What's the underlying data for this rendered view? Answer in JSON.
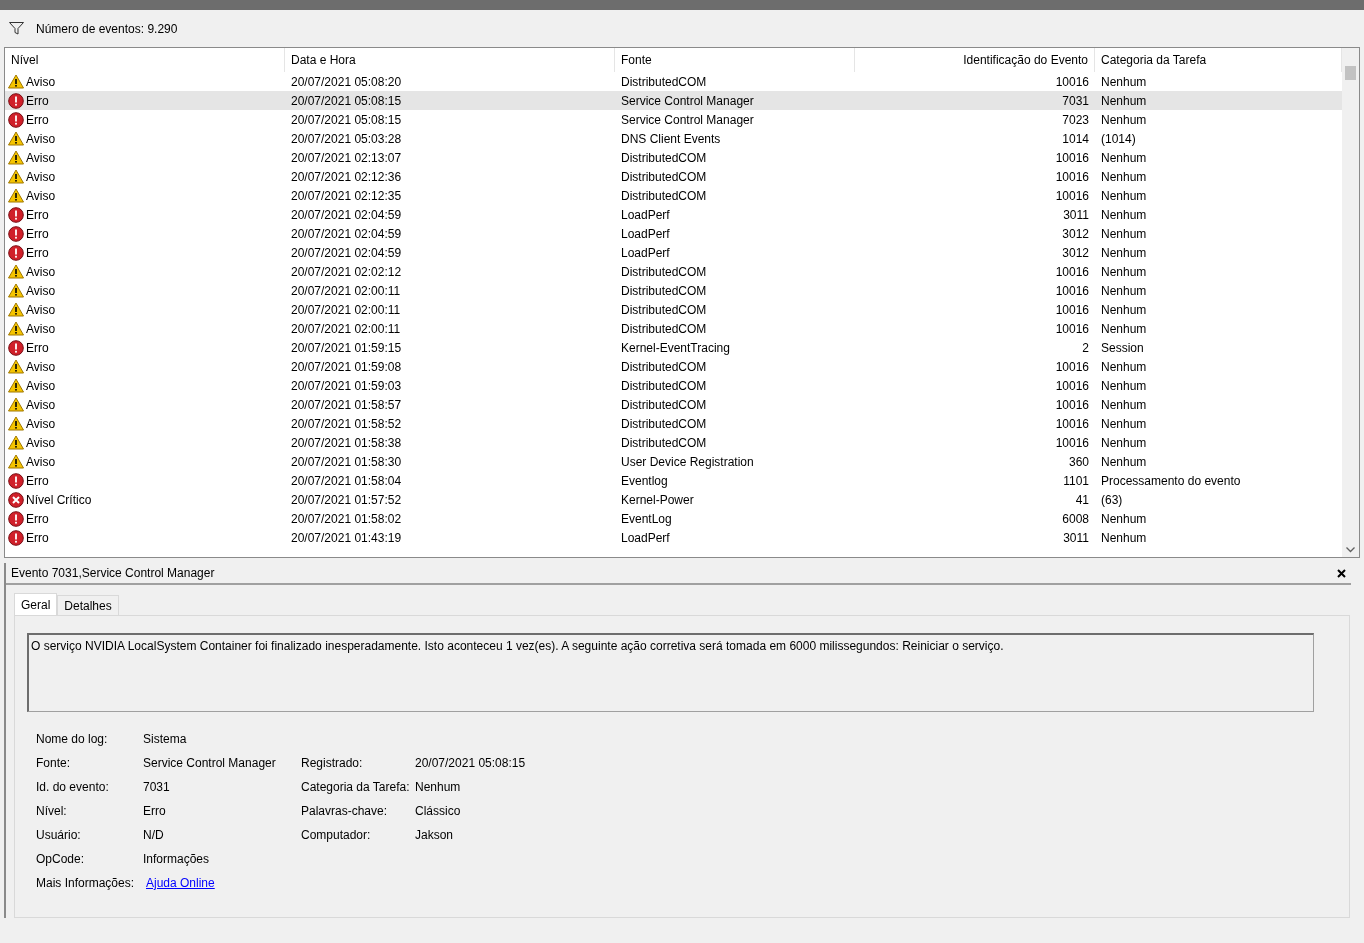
{
  "filter_bar": {
    "count_label": "Número de eventos: 9.290"
  },
  "table": {
    "columns": [
      "Nível",
      "Data e Hora",
      "Fonte",
      "Identificação do Evento",
      "Categoria da Tarefa"
    ],
    "rows": [
      {
        "kind": "warning",
        "level": "Aviso",
        "date": "20/07/2021 05:08:20",
        "source": "DistributedCOM",
        "id": "10016",
        "category": "Nenhum",
        "selected": false
      },
      {
        "kind": "error",
        "level": "Erro",
        "date": "20/07/2021 05:08:15",
        "source": "Service Control Manager",
        "id": "7031",
        "category": "Nenhum",
        "selected": true
      },
      {
        "kind": "error",
        "level": "Erro",
        "date": "20/07/2021 05:08:15",
        "source": "Service Control Manager",
        "id": "7023",
        "category": "Nenhum",
        "selected": false
      },
      {
        "kind": "warning",
        "level": "Aviso",
        "date": "20/07/2021 05:03:28",
        "source": "DNS Client Events",
        "id": "1014",
        "category": "(1014)",
        "selected": false
      },
      {
        "kind": "warning",
        "level": "Aviso",
        "date": "20/07/2021 02:13:07",
        "source": "DistributedCOM",
        "id": "10016",
        "category": "Nenhum",
        "selected": false
      },
      {
        "kind": "warning",
        "level": "Aviso",
        "date": "20/07/2021 02:12:36",
        "source": "DistributedCOM",
        "id": "10016",
        "category": "Nenhum",
        "selected": false
      },
      {
        "kind": "warning",
        "level": "Aviso",
        "date": "20/07/2021 02:12:35",
        "source": "DistributedCOM",
        "id": "10016",
        "category": "Nenhum",
        "selected": false
      },
      {
        "kind": "error",
        "level": "Erro",
        "date": "20/07/2021 02:04:59",
        "source": "LoadPerf",
        "id": "3011",
        "category": "Nenhum",
        "selected": false
      },
      {
        "kind": "error",
        "level": "Erro",
        "date": "20/07/2021 02:04:59",
        "source": "LoadPerf",
        "id": "3012",
        "category": "Nenhum",
        "selected": false
      },
      {
        "kind": "error",
        "level": "Erro",
        "date": "20/07/2021 02:04:59",
        "source": "LoadPerf",
        "id": "3012",
        "category": "Nenhum",
        "selected": false
      },
      {
        "kind": "warning",
        "level": "Aviso",
        "date": "20/07/2021 02:02:12",
        "source": "DistributedCOM",
        "id": "10016",
        "category": "Nenhum",
        "selected": false
      },
      {
        "kind": "warning",
        "level": "Aviso",
        "date": "20/07/2021 02:00:11",
        "source": "DistributedCOM",
        "id": "10016",
        "category": "Nenhum",
        "selected": false
      },
      {
        "kind": "warning",
        "level": "Aviso",
        "date": "20/07/2021 02:00:11",
        "source": "DistributedCOM",
        "id": "10016",
        "category": "Nenhum",
        "selected": false
      },
      {
        "kind": "warning",
        "level": "Aviso",
        "date": "20/07/2021 02:00:11",
        "source": "DistributedCOM",
        "id": "10016",
        "category": "Nenhum",
        "selected": false
      },
      {
        "kind": "error",
        "level": "Erro",
        "date": "20/07/2021 01:59:15",
        "source": "Kernel-EventTracing",
        "id": "2",
        "category": "Session",
        "selected": false
      },
      {
        "kind": "warning",
        "level": "Aviso",
        "date": "20/07/2021 01:59:08",
        "source": "DistributedCOM",
        "id": "10016",
        "category": "Nenhum",
        "selected": false
      },
      {
        "kind": "warning",
        "level": "Aviso",
        "date": "20/07/2021 01:59:03",
        "source": "DistributedCOM",
        "id": "10016",
        "category": "Nenhum",
        "selected": false
      },
      {
        "kind": "warning",
        "level": "Aviso",
        "date": "20/07/2021 01:58:57",
        "source": "DistributedCOM",
        "id": "10016",
        "category": "Nenhum",
        "selected": false
      },
      {
        "kind": "warning",
        "level": "Aviso",
        "date": "20/07/2021 01:58:52",
        "source": "DistributedCOM",
        "id": "10016",
        "category": "Nenhum",
        "selected": false
      },
      {
        "kind": "warning",
        "level": "Aviso",
        "date": "20/07/2021 01:58:38",
        "source": "DistributedCOM",
        "id": "10016",
        "category": "Nenhum",
        "selected": false
      },
      {
        "kind": "warning",
        "level": "Aviso",
        "date": "20/07/2021 01:58:30",
        "source": "User Device Registration",
        "id": "360",
        "category": "Nenhum",
        "selected": false
      },
      {
        "kind": "error",
        "level": "Erro",
        "date": "20/07/2021 01:58:04",
        "source": "Eventlog",
        "id": "1101",
        "category": "Processamento do evento",
        "selected": false
      },
      {
        "kind": "critical",
        "level": "Nível Crítico",
        "date": "20/07/2021 01:57:52",
        "source": "Kernel-Power",
        "id": "41",
        "category": "(63)",
        "selected": false
      },
      {
        "kind": "error",
        "level": "Erro",
        "date": "20/07/2021 01:58:02",
        "source": "EventLog",
        "id": "6008",
        "category": "Nenhum",
        "selected": false
      },
      {
        "kind": "error",
        "level": "Erro",
        "date": "20/07/2021 01:43:19",
        "source": "LoadPerf",
        "id": "3011",
        "category": "Nenhum",
        "selected": false
      }
    ]
  },
  "detail": {
    "title": "Evento 7031,Service Control Manager",
    "tabs": [
      {
        "label": "Geral",
        "selected": true
      },
      {
        "label": "Detalhes",
        "selected": false
      }
    ],
    "description": "O serviço NVIDIA LocalSystem Container foi finalizado inesperadamente. Isto aconteceu 1 vez(es). A seguinte ação corretiva será tomada em 6000 milissegundos: Reiniciar o serviço.",
    "fields": [
      [
        {
          "label": "Nome do log:",
          "value": "Sistema"
        }
      ],
      [
        {
          "label": "Fonte:",
          "value": "Service Control Manager"
        },
        {
          "label": "Registrado:",
          "value": "20/07/2021 05:08:15"
        }
      ],
      [
        {
          "label": "Id. do evento:",
          "value": "7031"
        },
        {
          "label": "Categoria da Tarefa:",
          "value": "Nenhum"
        }
      ],
      [
        {
          "label": "Nível:",
          "value": "Erro"
        },
        {
          "label": "Palavras-chave:",
          "value": "Clássico"
        }
      ],
      [
        {
          "label": "Usuário:",
          "value": "N/D"
        },
        {
          "label": "Computador:",
          "value": "Jakson"
        }
      ],
      [
        {
          "label": "OpCode:",
          "value": "Informações"
        }
      ],
      [
        {
          "label": "Mais Informações:",
          "link": "Ajuda Online"
        }
      ]
    ]
  }
}
